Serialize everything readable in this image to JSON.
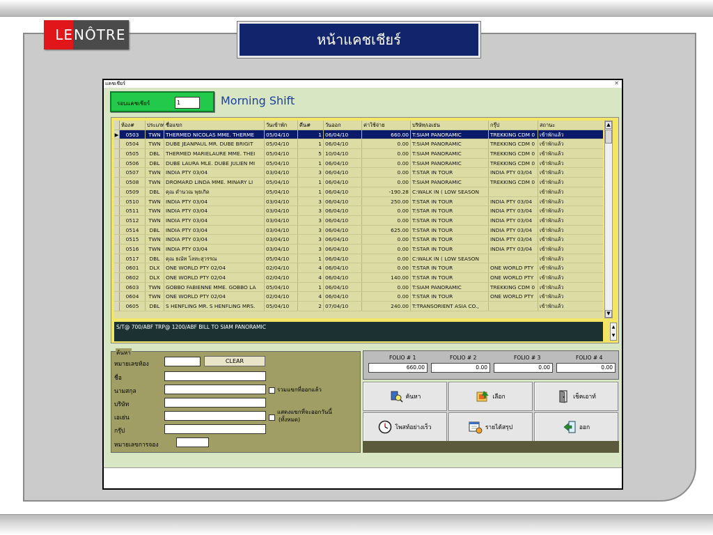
{
  "slide": {
    "logo_le": "LE",
    "logo_rest": "NÔTRE",
    "title": "หน้าแคชเชียร์"
  },
  "window": {
    "title": "แคชเชียร์",
    "close_glyph": "✕",
    "round_label": "รอบแคชเชียร์",
    "round_value": "1",
    "shift": "Morning Shift"
  },
  "grid": {
    "columns": [
      "ห้อง#",
      "ประเภท",
      "ชื่อแขก",
      "วันเข้าพัก",
      "คืน#",
      "วันออก",
      "ค่าใช้จ่าย",
      "บริษัท/เอเย่น",
      "กรุ๊ป",
      "สถานะ"
    ],
    "rows": [
      {
        "room": "0503",
        "type": "TWN",
        "name": "THERMED NICOLAS MME. THERME",
        "in": "05/04/10",
        "nights": "1",
        "out": "06/04/10",
        "expense": "660.00",
        "company": "T:SIAM PANORAMIC",
        "group": "TREKKING CDM 0",
        "status": "เข้าพักแล้ว",
        "selected": true
      },
      {
        "room": "0504",
        "type": "TWN",
        "name": "DUBE JEANPAUL MR. DUBE BRIGIT",
        "in": "05/04/10",
        "nights": "1",
        "out": "06/04/10",
        "expense": "0.00",
        "company": "T:SIAM PANORAMIC",
        "group": "TREKKING CDM 0",
        "status": "เข้าพักแล้ว"
      },
      {
        "room": "0505",
        "type": "DBL",
        "name": "THERMED MARIELAURE MME. THEI",
        "in": "05/04/10",
        "nights": "5",
        "out": "10/04/10",
        "expense": "0.00",
        "company": "T:SIAM PANORAMIC",
        "group": "TREKKING CDM 0",
        "status": "เข้าพักแล้ว"
      },
      {
        "room": "0506",
        "type": "DBL",
        "name": "DUBE LAURA MLE. DUBE JULIEN MI",
        "in": "05/04/10",
        "nights": "1",
        "out": "06/04/10",
        "expense": "0.00",
        "company": "T:SIAM PANORAMIC",
        "group": "TREKKING CDM 0",
        "status": "เข้าพักแล้ว"
      },
      {
        "room": "0507",
        "type": "TWN",
        "name": "INDIA PTY 03/04",
        "in": "03/04/10",
        "nights": "3",
        "out": "06/04/10",
        "expense": "0.00",
        "company": "T:STAR IN TOUR",
        "group": "INDIA PTY 03/04",
        "status": "เข้าพักแล้ว"
      },
      {
        "room": "0508",
        "type": "TWN",
        "name": "DROMARD LINDA MME. MINARY LI",
        "in": "05/04/10",
        "nights": "1",
        "out": "06/04/10",
        "expense": "0.00",
        "company": "T:SIAM PANORAMIC",
        "group": "TREKKING CDM 0",
        "status": "เข้าพักแล้ว"
      },
      {
        "room": "0509",
        "type": "DBL",
        "name": "คุณ ดำนวณ พุธเกิด",
        "in": "05/04/10",
        "nights": "1",
        "out": "06/04/10",
        "expense": "-190.28",
        "company": "C:WALK IN ( LOW SEASON",
        "group": "",
        "status": "เข้าพักแล้ว"
      },
      {
        "room": "0510",
        "type": "TWN",
        "name": "INDIA PTY 03/04",
        "in": "03/04/10",
        "nights": "3",
        "out": "06/04/10",
        "expense": "250.00",
        "company": "T:STAR IN TOUR",
        "group": "INDIA PTY 03/04",
        "status": "เข้าพักแล้ว"
      },
      {
        "room": "0511",
        "type": "TWN",
        "name": "INDIA PTY 03/04",
        "in": "03/04/10",
        "nights": "3",
        "out": "06/04/10",
        "expense": "0.00",
        "company": "T:STAR IN TOUR",
        "group": "INDIA PTY 03/04",
        "status": "เข้าพักแล้ว"
      },
      {
        "room": "0512",
        "type": "TWN",
        "name": "INDIA PTY 03/04",
        "in": "03/04/10",
        "nights": "3",
        "out": "06/04/10",
        "expense": "0.00",
        "company": "T:STAR IN TOUR",
        "group": "INDIA PTY 03/04",
        "status": "เข้าพักแล้ว"
      },
      {
        "room": "0514",
        "type": "DBL",
        "name": "INDIA PTY 03/04",
        "in": "03/04/10",
        "nights": "3",
        "out": "06/04/10",
        "expense": "625.00",
        "company": "T:STAR IN TOUR",
        "group": "INDIA PTY 03/04",
        "status": "เข้าพักแล้ว"
      },
      {
        "room": "0515",
        "type": "TWN",
        "name": "INDIA PTY 03/04",
        "in": "03/04/10",
        "nights": "3",
        "out": "06/04/10",
        "expense": "0.00",
        "company": "T:STAR IN TOUR",
        "group": "INDIA PTY 03/04",
        "status": "เข้าพักแล้ว"
      },
      {
        "room": "0516",
        "type": "TWN",
        "name": "INDIA PTY 03/04",
        "in": "03/04/10",
        "nights": "3",
        "out": "06/04/10",
        "expense": "0.00",
        "company": "T:STAR IN TOUR",
        "group": "INDIA PTY 03/04",
        "status": "เข้าพักแล้ว"
      },
      {
        "room": "0517",
        "type": "DBL",
        "name": "คุณ ธณัท โลหะสุวรรณ",
        "in": "05/04/10",
        "nights": "1",
        "out": "06/04/10",
        "expense": "0.00",
        "company": "C:WALK IN ( LOW SEASON",
        "group": "",
        "status": "เข้าพักแล้ว"
      },
      {
        "room": "0601",
        "type": "DLX",
        "name": "ONE WORLD PTY 02/04",
        "in": "02/04/10",
        "nights": "4",
        "out": "06/04/10",
        "expense": "0.00",
        "company": "T:STAR IN TOUR",
        "group": "ONE WORLD PTY",
        "status": "เข้าพักแล้ว"
      },
      {
        "room": "0602",
        "type": "DLX",
        "name": "ONE WORLD PTY 02/04",
        "in": "02/04/10",
        "nights": "4",
        "out": "06/04/10",
        "expense": "140.00",
        "company": "T:STAR IN TOUR",
        "group": "ONE WORLD PTY",
        "status": "เข้าพักแล้ว"
      },
      {
        "room": "0603",
        "type": "TWN",
        "name": "GOBBO FABIENNE MME. GOBBO LA",
        "in": "05/04/10",
        "nights": "1",
        "out": "06/04/10",
        "expense": "0.00",
        "company": "T:SIAM PANORAMIC",
        "group": "TREKKING CDM 0",
        "status": "เข้าพักแล้ว"
      },
      {
        "room": "0604",
        "type": "TWN",
        "name": "ONE WORLD PTY 02/04",
        "in": "02/04/10",
        "nights": "4",
        "out": "06/04/10",
        "expense": "0.00",
        "company": "T:STAR IN TOUR",
        "group": "ONE WORLD PTY",
        "status": "เข้าพักแล้ว"
      },
      {
        "room": "0605",
        "type": "DBL",
        "name": "S HENFLING MR. S HENFLING MRS.",
        "in": "05/04/10",
        "nights": "2",
        "out": "07/04/10",
        "expense": "240.00",
        "company": "T:TRANSORIENT ASIA CO.,",
        "group": "",
        "status": "เข้าพักแล้ว"
      }
    ],
    "note": "S/T@ 700/ABF  TRP@ 1200/ABF   BILL TO SIAM PANORAMIC"
  },
  "search": {
    "legend": "ค้นหา",
    "room_label": "หมายเลขห้อง",
    "clear_label": "CLEAR",
    "name_label": "ชื่อ",
    "surname_label": "นามสกุล",
    "company_label": "บริษัท",
    "agent_label": "เอเย่น",
    "group_label": "กรุ๊ป",
    "booking_label": "หมายเลขการจอง",
    "include_checkout_label": "รวมแขกที่ออกแล้ว",
    "show_today_checkout_label_1": "แสดงแขกที่จะออกวันนี้",
    "show_today_checkout_label_2": "(ทั้งหมด)"
  },
  "folio": {
    "labels": [
      "FOLIO # 1",
      "FOLIO # 2",
      "FOLIO # 3",
      "FOLIO # 4"
    ],
    "values": [
      "660.00",
      "0.00",
      "0.00",
      "0.00"
    ]
  },
  "actions": {
    "search": "ค้นหา",
    "select": "เลือก",
    "checkout": "เช็คเอาท์",
    "quick_post": "โพสท์อย่างเร็ว",
    "income_summary": "รายได้สรุป",
    "exit": "ออก"
  }
}
